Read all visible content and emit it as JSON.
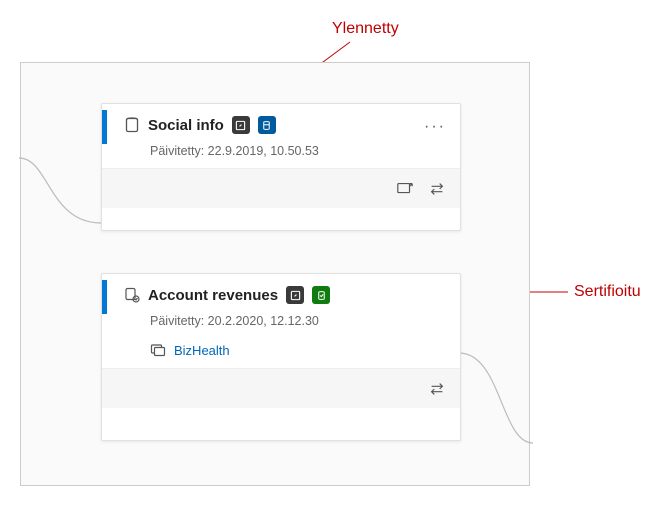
{
  "annotations": {
    "top": "Ylennetty",
    "right": "Sertifioitu"
  },
  "cards": [
    {
      "title": "Social info",
      "updated_label": "Päivitetty: 22.9.2019, 10.50.53",
      "more": "···"
    },
    {
      "title": "Account revenues",
      "updated_label": "Päivitetty: 20.2.2020, 12.12.30",
      "workspace_link": "BizHealth"
    }
  ]
}
